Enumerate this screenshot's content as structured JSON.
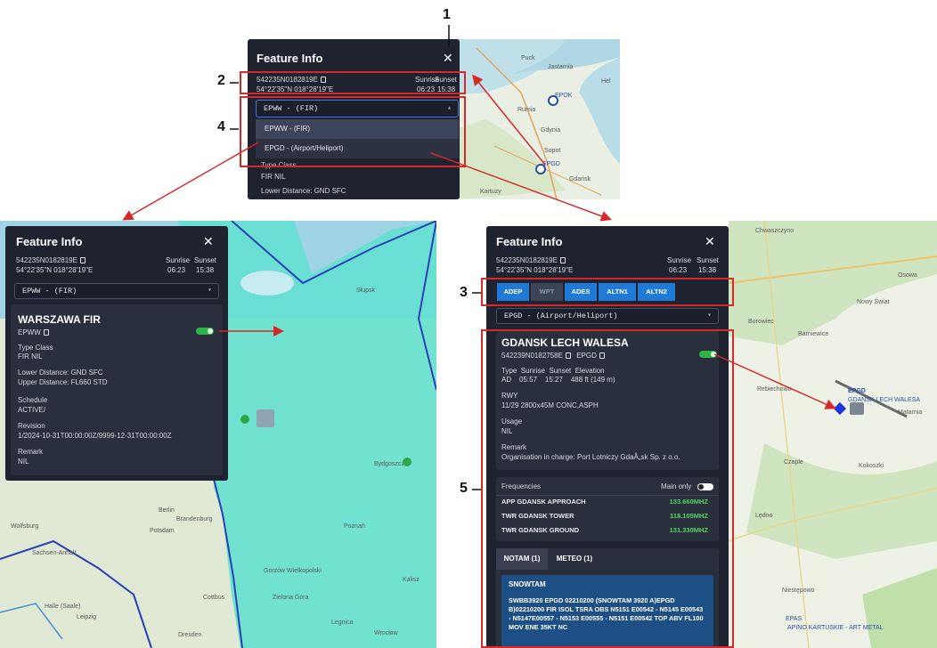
{
  "callouts": [
    "1",
    "2",
    "3",
    "4",
    "5"
  ],
  "top_panel": {
    "title": "Feature Info",
    "coord_packed": "542235N0182819E",
    "coord_dms": "54°22'35\"N 018°28'19\"E",
    "sunrise_label": "Sunrise",
    "sunset_label": "Sunset",
    "sunrise": "06:23",
    "sunset": "15:38",
    "select_value": "EPWW - (FIR)",
    "options": [
      "EPWW - (FIR)",
      "EPGD - (Airport/Heliport)"
    ],
    "peek_type_class": "Type  Class",
    "peek_type_val": "FIR   NIL",
    "peek_lower": "Lower Distance:  GND  SFC"
  },
  "top_map_labels": [
    "Puck",
    "Jastarnia",
    "Hel",
    "EPOK",
    "Rumia",
    "Gdynia",
    "Sopot",
    "EPGD",
    "Gdańsk",
    "Kartuzy"
  ],
  "left_panel": {
    "title": "Feature Info",
    "coord_packed": "542235N0182819E",
    "coord_dms": "54°22'35\"N 018°28'19\"E",
    "sunrise_label": "Sunrise",
    "sunset_label": "Sunset",
    "sunrise": "06:23",
    "sunset": "15:38",
    "select_value": "EPWW - (FIR)",
    "name": "WARSZAWA FIR",
    "code": "EPWW",
    "type_class_label": "Type  Class",
    "type_class_val": "FIR   NIL",
    "lower": "Lower Distance:  GND  SFC",
    "upper": "Upper Distance:  FL660  STD",
    "schedule_label": "Schedule",
    "schedule_val": "ACTIVE/",
    "revision_label": "Revision",
    "revision_val": "1/2024-10-31T00:00:00Z/9999-12-31T00:00:00Z",
    "remark_label": "Remark",
    "remark_val": "NIL"
  },
  "left_map_labels": [
    "Słupsk",
    "Bydgoszcz",
    "Berlin",
    "Brandenburg",
    "Potsdam",
    "Gorzów Wielkopolski",
    "Zielona Góra",
    "Poznań",
    "Wolfsburg",
    "Sachsen-Anhalt",
    "Halle (Saale)",
    "Leipzig",
    "Dresden",
    "Cottbus",
    "Legnica",
    "Wrocław",
    "Kalisz"
  ],
  "right_panel": {
    "title": "Feature Info",
    "coord_packed": "542235N0182819E",
    "coord_dms": "54°22'35\"N 018°28'19\"E",
    "sunrise_label": "Sunrise",
    "sunset_label": "Sunset",
    "sunrise": "06:23",
    "sunset": "15:38",
    "tabs": [
      {
        "label": "ADEP",
        "enabled": true
      },
      {
        "label": "WPT",
        "enabled": false
      },
      {
        "label": "ADES",
        "enabled": true
      },
      {
        "label": "ALTN1",
        "enabled": true
      },
      {
        "label": "ALTN2",
        "enabled": true
      }
    ],
    "select_value": "EPGD - (Airport/Heliport)",
    "name": "GDANSK LECH WALESA",
    "coord_code": "542239N0182758E",
    "code": "EPGD",
    "info_header": "Type  Sunrise  Sunset  Elevation",
    "info_vals": "AD    05:57    15:27    488 ft (149 m)",
    "rwy_label": "RWY",
    "rwy_val": "11/29 2800x45M CONC,ASPH",
    "usage_label": "Usage",
    "usage_val": "NIL",
    "remark_label": "Remark",
    "remark_val": "Organisation in charge: Port Lotniczy GdaÅ„sk Sp. z o.o.",
    "freq_label": "Frequencies",
    "main_only": "Main only",
    "frequencies": [
      {
        "name": "APP GDANSK APPROACH",
        "value": "133.660MHZ"
      },
      {
        "name": "TWR GDANSK TOWER",
        "value": "118.105MHZ"
      },
      {
        "name": "TWR GDANSK GROUND",
        "value": "131.330MHZ"
      }
    ],
    "notam_tab": "NOTAM (1)",
    "meteo_tab": "METEO (1)",
    "snowtam_title": "SNOWTAM",
    "snowtam_text": "SWBB3920 EPGD 02210200  (SNOWTAM 3920  A)EPGD B)02210200  FIR ISOL TSRA OBS N5151 E00542 - N5145 E00543 - N5147E00557 - N5153 E00555 - N5151 E00542 TOP ABV FL100 MOV ENE 35KT NC"
  },
  "right_map_labels": [
    "Chwaszczyno",
    "Osowa",
    "Nowy Świat",
    "Borowiec",
    "Barniewice",
    "Rebiechowo",
    "Czaple",
    "Kokoszki",
    "Lędno",
    "Niestępowo",
    "EPAS",
    "EPGD",
    "GDANSK LECH WALESA",
    "Matarnia",
    "APINO KARTUSKIE - ART METAL"
  ]
}
